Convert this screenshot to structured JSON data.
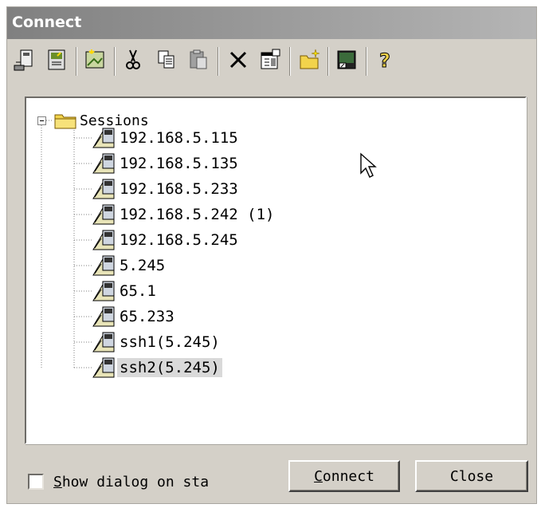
{
  "window": {
    "title": "Connect"
  },
  "toolbar": {
    "buttons": [
      {
        "icon": "quick-connect-icon"
      },
      {
        "icon": "connect-in-tab-icon"
      },
      {
        "icon": "new-session-icon"
      },
      {
        "icon": "cut-icon"
      },
      {
        "icon": "copy-icon"
      },
      {
        "icon": "paste-icon"
      },
      {
        "icon": "delete-icon"
      },
      {
        "icon": "properties-icon"
      },
      {
        "icon": "new-folder-icon"
      },
      {
        "icon": "desktop-shortcut-icon"
      },
      {
        "icon": "help-icon"
      }
    ]
  },
  "tree": {
    "root": {
      "label": "Sessions",
      "expanded": true
    },
    "items": [
      {
        "label": "192.168.5.115"
      },
      {
        "label": "192.168.5.135"
      },
      {
        "label": "192.168.5.233"
      },
      {
        "label": "192.168.5.242 (1)"
      },
      {
        "label": "192.168.5.245"
      },
      {
        "label": "5.245"
      },
      {
        "label": "65.1"
      },
      {
        "label": "65.233"
      },
      {
        "label": "ssh1(5.245)"
      },
      {
        "label": "ssh2(5.245)",
        "selected": true
      }
    ]
  },
  "footer": {
    "checkbox": {
      "label_first": "S",
      "label_rest": "how dialog on sta",
      "checked": false
    },
    "connect_button": {
      "label_first": "C",
      "label_rest": "onnect"
    },
    "close_button": {
      "label": "Close"
    }
  },
  "colors": {
    "titlebar_start": "#808080",
    "titlebar_end": "#b5b5b5",
    "window_bg": "#d4d0c8",
    "selection_bg": "#d9d9d9"
  }
}
